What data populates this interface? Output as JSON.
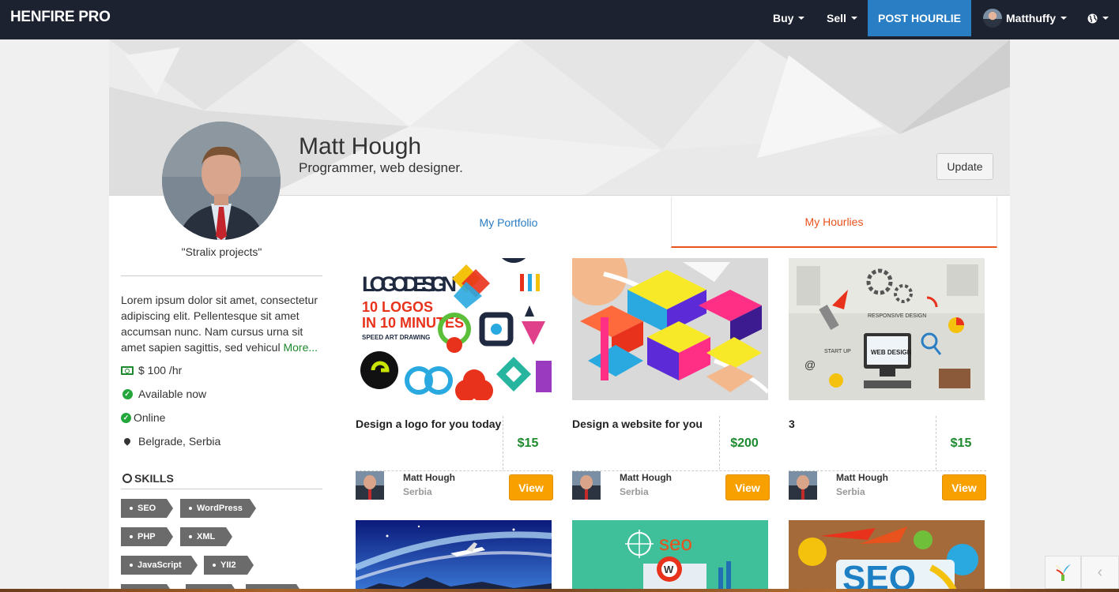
{
  "nav": {
    "brand": "HENFIRE PRO",
    "buy": "Buy",
    "sell": "Sell",
    "post": "POST HOURLIE",
    "user": "Matthuffy"
  },
  "profile": {
    "name": "Matt Hough",
    "title": "Programmer, web designer.",
    "update_label": "Update",
    "company": "\"Stralix projects\"",
    "about": "Lorem ipsum dolor sit amet, consectetur adipiscing elit. Pellentesque sit amet accumsan nunc. Nam cursus urna sit amet sapien sagittis, sed vehicul",
    "more": "More...",
    "rate": "$ 100 /hr",
    "availability": "Available now",
    "status": "Online",
    "location": "Belgrade, Serbia"
  },
  "skills": {
    "title": "SKILLS",
    "tags": [
      "SEO",
      "WordPress",
      "PHP",
      "XML",
      "JavaScript",
      "YII2"
    ]
  },
  "tabs": {
    "portfolio": "My Portfolio",
    "hourlies": "My Hourlies"
  },
  "cards": [
    {
      "title": "Design a logo for you today",
      "price": "$15",
      "owner": "Matt Hough",
      "country": "Serbia",
      "view": "View",
      "image_text": {
        "line1": "LOGO DESIGN",
        "line2": "10 LOGOS",
        "line3": "IN 10 MINUTES",
        "line4": "SPEED ART DRAWING"
      }
    },
    {
      "title": "Design a website for you",
      "price": "$200",
      "owner": "Matt Hough",
      "country": "Serbia",
      "view": "View"
    },
    {
      "title": "3",
      "price": "$15",
      "owner": "Matt Hough",
      "country": "Serbia",
      "view": "View",
      "image_text": {
        "center": "WEB DESIGN",
        "top": "RESPONSIVE DESIGN",
        "left": "START UP"
      }
    }
  ],
  "second_row": {
    "seo_label": "seo",
    "seo_big": "SEO"
  },
  "colors": {
    "navbar": "#1c2230",
    "post_button": "#2a7ec4",
    "tab_active": "#e8521c",
    "price": "#1d8a2e",
    "view_button": "#f7a000"
  },
  "icons": [
    "caret-down-icon",
    "globe-icon",
    "money-icon",
    "check-circle-icon",
    "map-marker-icon",
    "circle-icon",
    "yii-logo-icon",
    "chevron-left-icon"
  ]
}
